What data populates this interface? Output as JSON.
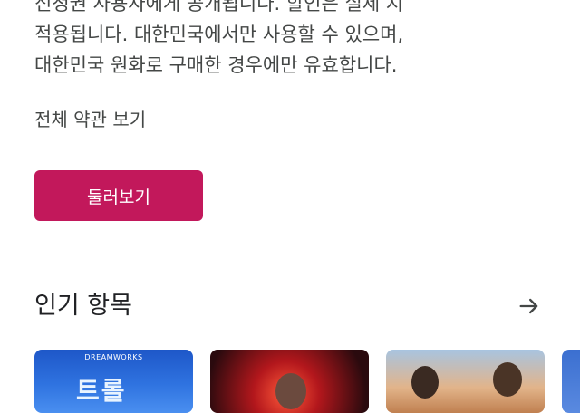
{
  "description": {
    "line1": "신청권 사용자에게 공개됩니다. 할인은 실제 지",
    "line2": "적용됩니다. 대한민국에서만 사용할 수 있으며,",
    "line3": "대한민국 원화로 구매한 경우에만 유효합니다."
  },
  "terms_link": "전체 약관 보기",
  "browse_button": "둘러보기",
  "popular": {
    "title": "인기 항목",
    "arrow_icon": "arrow-right-icon"
  },
  "thumbnails": [
    {
      "logo": "DREAMWORKS",
      "title": "트롤"
    },
    {
      "logo": "",
      "title": ""
    },
    {
      "logo": "",
      "title": ""
    },
    {
      "logo": "",
      "title": ""
    }
  ],
  "colors": {
    "accent": "#c2185b",
    "text": "#444746"
  }
}
